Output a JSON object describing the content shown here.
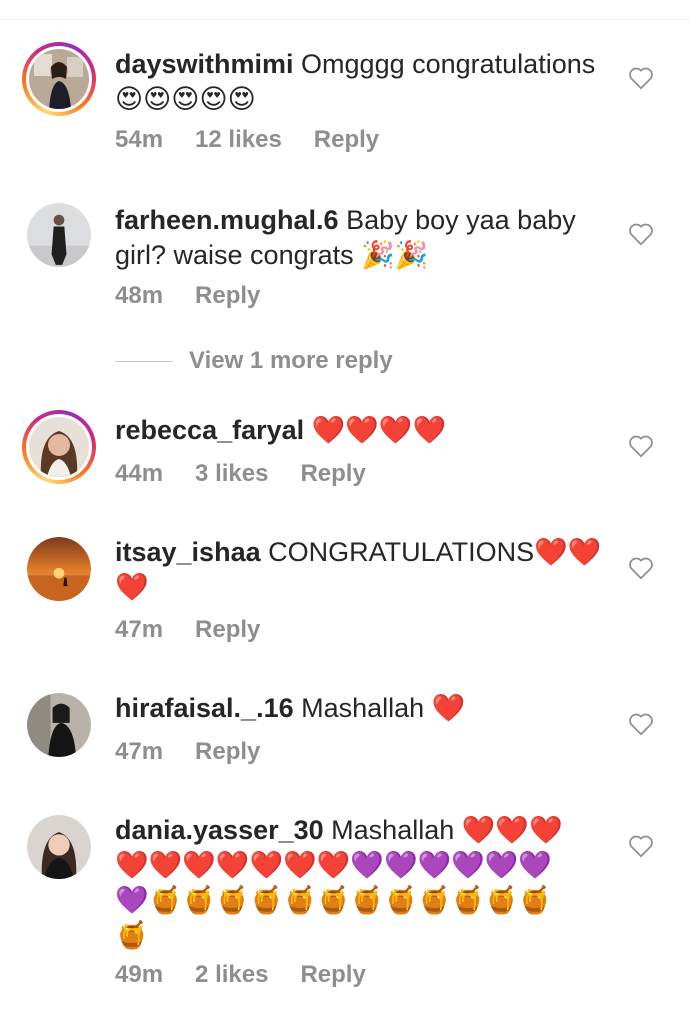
{
  "comments": [
    {
      "username": "dayswithmimi",
      "text": " Omgggg congratulations ",
      "emoji": "😍😍😍😍😍",
      "time": "54m",
      "likes": "12 likes",
      "reply": "Reply",
      "has_story": true,
      "avatar_icon": "profile-photo-woman-violin"
    },
    {
      "username": "farheen.mughal.6",
      "text": " Baby boy yaa baby girl? waise congrats ",
      "emoji": "🎉🎉",
      "time": "48m",
      "likes": "",
      "reply": "Reply",
      "has_story": false,
      "avatar_icon": "profile-photo-woman-standing"
    },
    {
      "username": "rebecca_faryal",
      "text": " ",
      "emoji": "❤️❤️❤️❤️",
      "time": "44m",
      "likes": "3 likes",
      "reply": "Reply",
      "has_story": true,
      "avatar_icon": "profile-photo-woman-smiling"
    },
    {
      "username": "itsay_ishaa",
      "text": " CONGRATULATIONS",
      "emoji": "❤️❤️❤️",
      "time": "47m",
      "likes": "",
      "reply": "Reply",
      "has_story": false,
      "avatar_icon": "profile-photo-sunset-beach"
    },
    {
      "username": "hirafaisal._.16",
      "text": " Mashallah ",
      "emoji": "❤️",
      "time": "47m",
      "likes": "",
      "reply": "Reply",
      "has_story": false,
      "avatar_icon": "profile-photo-woman-sitting"
    },
    {
      "username": "dania.yasser_30",
      "text": " Mashallah ",
      "emoji": "❤️❤️❤️❤️❤️❤️❤️❤️❤️❤️💜💜💜💜💜💜💜🍯🍯🍯🍯🍯🍯🍯🍯🍯🍯🍯🍯🍯",
      "time": "49m",
      "likes": "2 likes",
      "reply": "Reply",
      "has_story": false,
      "avatar_icon": "profile-photo-woman-portrait"
    }
  ],
  "view_replies": {
    "label": "View 1 more reply"
  },
  "icons": {
    "like": "heart-outline-icon"
  },
  "colors": {
    "text": "#262626",
    "secondary": "#8e8e8e",
    "story_ring": [
      "#feda75",
      "#fa7e1e",
      "#d62976",
      "#962fbf"
    ]
  }
}
